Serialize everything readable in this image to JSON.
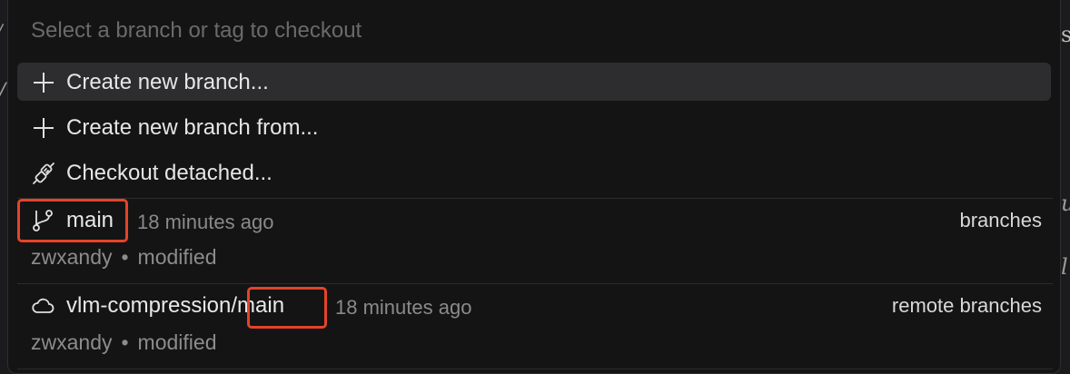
{
  "search": {
    "placeholder": "Select a branch or tag to checkout"
  },
  "actions": [
    {
      "label": "Create new branch...",
      "icon": "plus-icon"
    },
    {
      "label": "Create new branch from...",
      "icon": "plus-icon"
    },
    {
      "label": "Checkout detached...",
      "icon": "plug-icon"
    }
  ],
  "refs": [
    {
      "name": "main",
      "name_prefix": "",
      "time": "18 minutes ago",
      "kind": "branches",
      "author": "zwxandy",
      "separator": "•",
      "status": "modified",
      "icon": "git-branch-icon"
    },
    {
      "name": "main",
      "name_prefix": "vlm-compression",
      "name_slash": "/",
      "time": "18 minutes ago",
      "kind": "remote branches",
      "author": "zwxandy",
      "separator": "•",
      "status": "modified",
      "icon": "cloud-icon"
    }
  ],
  "colors": {
    "highlight_box": "#e5432a",
    "selection": "#2d2d2f"
  }
}
